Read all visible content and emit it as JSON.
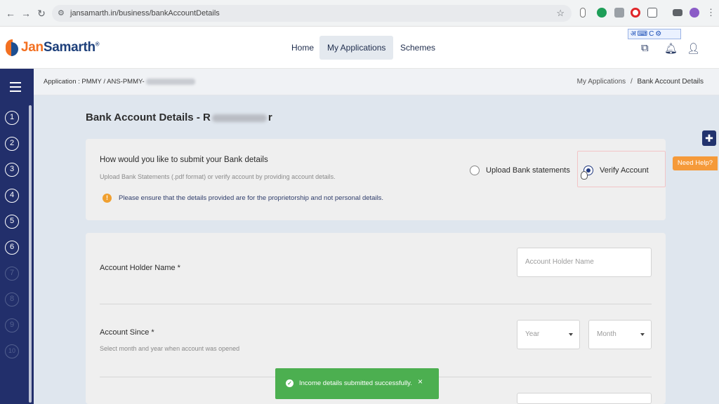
{
  "browser": {
    "url": "jansamarth.in/business/bankAccountDetails",
    "back": "←",
    "forward": "→",
    "reload": "↻",
    "tune_icon": "⚙",
    "star_icon": "☆"
  },
  "header": {
    "logo_part1": "Jan",
    "logo_part2": "Samarth",
    "logo_tm": "®",
    "nav": [
      "Home",
      "My Applications",
      "Schemes"
    ],
    "active_nav": "My Applications",
    "language_widget": "अ⌨C⚙"
  },
  "sidebar": {
    "steps": [
      "1",
      "2",
      "3",
      "4",
      "5",
      "6",
      "7",
      "8",
      "9",
      "10"
    ],
    "completed_steps": 6
  },
  "breadcrumb": {
    "application_id": "Application : PMMY / ANS-PMMY-",
    "path": "My Applications",
    "separator": "/",
    "current": "Bank Account Details"
  },
  "page": {
    "title_prefix": "Bank Account Details - R",
    "title_suffix": "r"
  },
  "submit_card": {
    "question": "How would you like to submit your Bank details",
    "subtext": "Upload Bank Statements (.pdf format) or verify account by providing account details.",
    "notice_icon": "!",
    "notice": "Please ensure that the details provided are for the proprietorship and not personal details.",
    "option_upload": "Upload Bank statements",
    "option_verify": "Verify Account",
    "selected": "Verify Account"
  },
  "form": {
    "holder_label": "Account Holder Name *",
    "holder_placeholder": "Account Holder Name",
    "since_label": "Account Since *",
    "since_hint": "Select month and year when account was opened",
    "year_value": "Year",
    "month_value": "Month"
  },
  "help": {
    "plus": "✚",
    "need_help": "Need Help?"
  },
  "toast": {
    "icon": "✓",
    "message": "Income details submitted successfully.",
    "close": "×"
  },
  "colors": {
    "sidebar": "#222f6b",
    "brand_orange": "#f37021",
    "toast_green": "#4caf50",
    "need_help": "#f59a3a"
  }
}
